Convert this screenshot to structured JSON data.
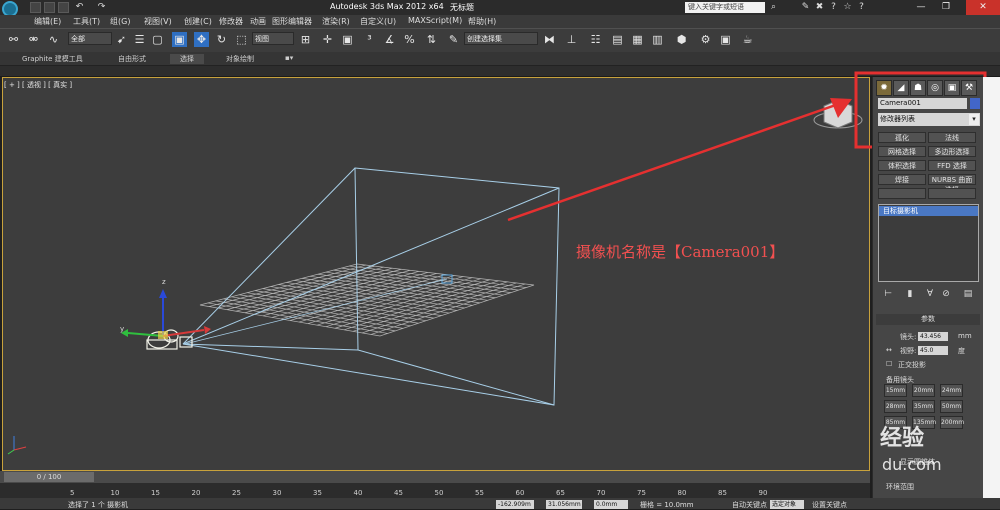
{
  "titlebar": {
    "app_title": "Autodesk 3ds Max  2012 x64",
    "filename": "无标题",
    "search_placeholder": "键入关键字或短语"
  },
  "menu": {
    "items": [
      "编辑(E)",
      "工具(T)",
      "组(G)",
      "视图(V)",
      "创建(C)",
      "修改器",
      "动画",
      "图形编辑器",
      "渲染(R)",
      "自定义(U)",
      "MAXScript(M)",
      "帮助(H)"
    ]
  },
  "toolbar": {
    "filter_select": "全部",
    "coord_select": "视图",
    "named_selection": "创建选择集"
  },
  "ribbon": {
    "tabs": [
      "Graphite 建模工具",
      "自由形式",
      "选择",
      "对象绘制"
    ]
  },
  "viewport": {
    "label": "[ + ] [ 透视 ] [ 真实 ]",
    "annotation": "摄像机名称是【Camera001】",
    "axis_y": "y",
    "axis_z": "z",
    "axis_x": "x"
  },
  "cmdpanel": {
    "object_name": "Camera001",
    "modifier_list": "修改器列表",
    "buttons": [
      "网格选择",
      "多边形选择",
      "体积选择",
      "FFD 选择",
      "焊接",
      "NURBS 曲面选择"
    ],
    "tab_labels": [
      "孤化",
      "法线"
    ],
    "stack_item": "目标摄影机",
    "params_title": "参数",
    "lens_label": "镜头:",
    "lens_value": "43.456",
    "lens_unit": "mm",
    "fov_label": "视野:",
    "fov_value": "45.0",
    "fov_unit": "度",
    "ortho_label": "正交投影",
    "stock_lens_title": "备用镜头",
    "stock_lenses": [
      "15mm",
      "20mm",
      "24mm",
      "28mm",
      "35mm",
      "50mm",
      "85mm",
      "135mm",
      "200mm"
    ],
    "show_cone": "显示圆锥体",
    "env_range": "环境范围"
  },
  "timeline": {
    "position": "0 / 100",
    "ticks": [
      "5",
      "10",
      "15",
      "20",
      "25",
      "30",
      "35",
      "40",
      "45",
      "50",
      "55",
      "60",
      "65",
      "70",
      "75",
      "80",
      "85",
      "90"
    ]
  },
  "status": {
    "selection_text": "选择了 1 个 摄影机",
    "x_value": "-162.909m",
    "y_value": "31.056mm",
    "z_value": "0.0mm",
    "grid": "栅格 = 10.0mm",
    "auto_key": "自动关键点",
    "selected": "选定对象",
    "set_key": "设置关键点"
  },
  "watermark": {
    "text": "经验",
    "url": "du.com"
  },
  "colors": {
    "annotation": "#f25050",
    "frustum": "#a8cfe8",
    "grid": "#c9c9c9",
    "highlight_box": "#e53030",
    "viewport_border": "#c8a23c"
  }
}
